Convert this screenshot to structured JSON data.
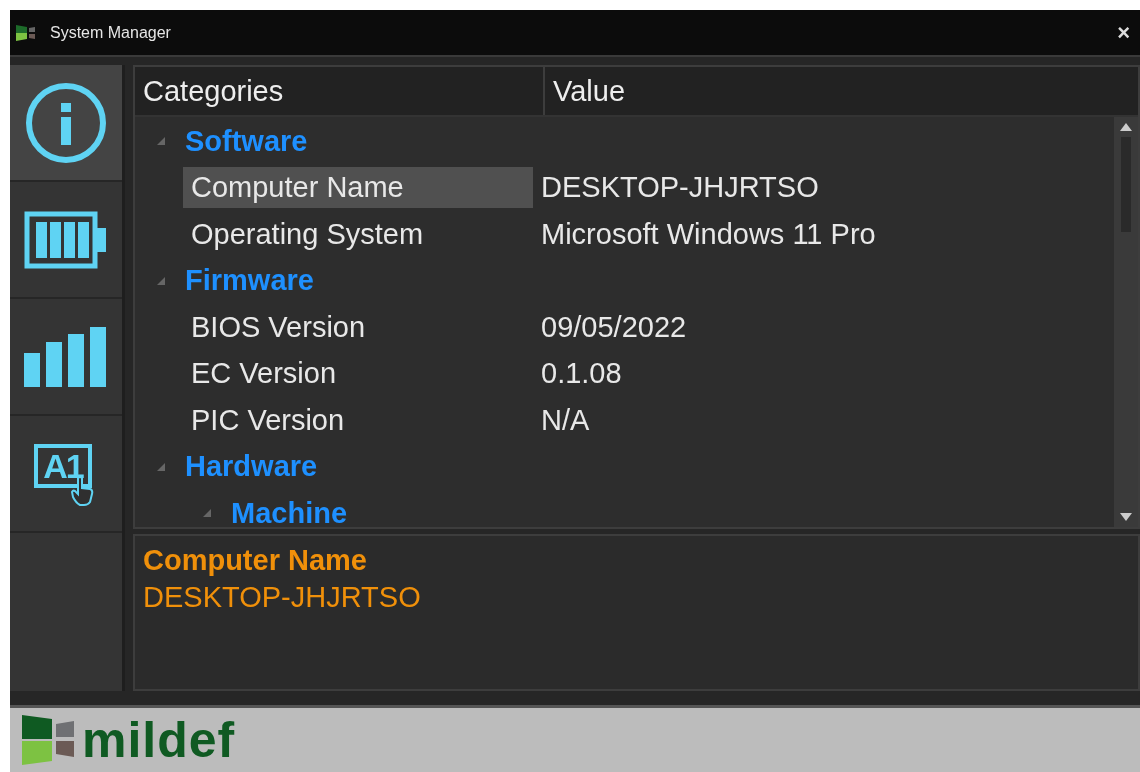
{
  "window": {
    "title": "System Manager",
    "close": "×"
  },
  "sidebar": {
    "items": [
      {
        "kind": "info",
        "selected": true
      },
      {
        "kind": "battery",
        "selected": false
      },
      {
        "kind": "signal",
        "selected": false
      },
      {
        "kind": "cell",
        "glyph": "A1",
        "selected": false
      }
    ]
  },
  "table": {
    "columns": [
      "Categories",
      "Value"
    ],
    "rows": [
      {
        "kind": "category",
        "label": "Software",
        "expanded": true,
        "children": [
          {
            "kind": "item",
            "label": "Computer Name",
            "value": "DESKTOP-JHJRTSO",
            "selected": true
          },
          {
            "kind": "item",
            "label": "Operating System",
            "value": "Microsoft Windows 11 Pro",
            "selected": false
          }
        ]
      },
      {
        "kind": "category",
        "label": "Firmware",
        "expanded": true,
        "children": [
          {
            "kind": "item",
            "label": "BIOS Version",
            "value": "09/05/2022",
            "selected": false
          },
          {
            "kind": "item",
            "label": "EC Version",
            "value": "0.1.08",
            "selected": false
          },
          {
            "kind": "item",
            "label": "PIC Version",
            "value": "N/A",
            "selected": false
          }
        ]
      },
      {
        "kind": "category",
        "label": "Hardware",
        "expanded": true,
        "children": [
          {
            "kind": "category",
            "label": "Machine",
            "expanded": true
          }
        ]
      }
    ]
  },
  "detail": {
    "title": "Computer Name",
    "value": "DESKTOP-JHJRTSO"
  },
  "footer": {
    "logo": "mildef"
  }
}
